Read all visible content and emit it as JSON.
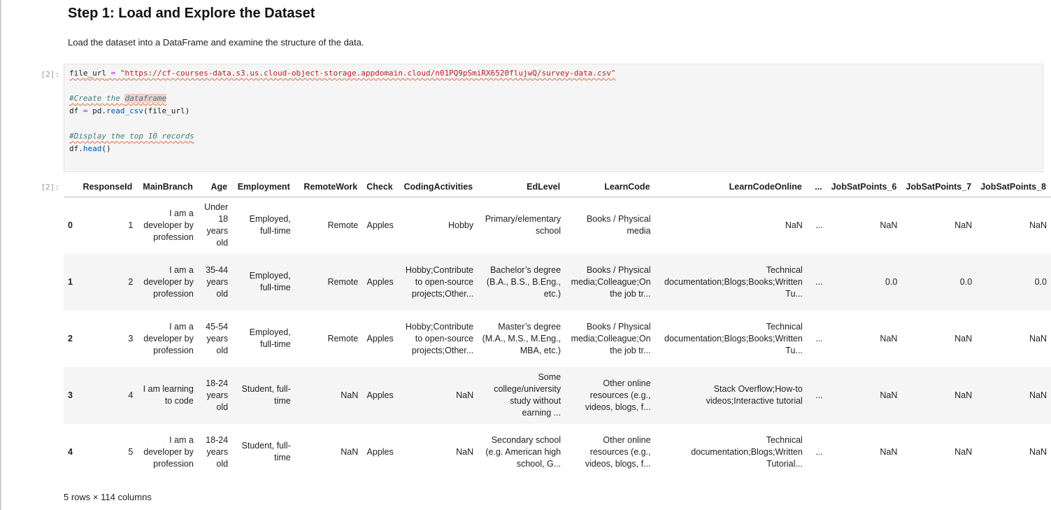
{
  "markdown": {
    "title": "Step 1: Load and Explore the Dataset",
    "text": "Load the dataset into a DataFrame and examine the structure of the data."
  },
  "code_cell": {
    "prompt": "[2]:",
    "line1_var": "file_url",
    "line1_eq": " = ",
    "line1_str": "\"https://cf-courses-data.s3.us.cloud-object-storage.appdomain.cloud/n01PQ9pSmiRX6520flujwQ/survey-data.csv\"",
    "comment1_a": "#Create the ",
    "comment1_b": "dataframe",
    "line2_a": "df ",
    "line2_eq": "=",
    "line2_b": " pd.",
    "line2_fn": "read_csv",
    "line2_c": "(file_url)",
    "comment2": "#Display the top 10 records",
    "line3_a": "df.",
    "line3_fn": "head",
    "line3_b": "()"
  },
  "output": {
    "prompt": "[2]:",
    "columns": [
      "",
      "ResponseId",
      "MainBranch",
      "Age",
      "Employment",
      "RemoteWork",
      "Check",
      "CodingActivities",
      "EdLevel",
      "LearnCode",
      "LearnCodeOnline",
      "...",
      "JobSatPoints_6",
      "JobSatPoints_7",
      "JobSatPoints_8"
    ],
    "rows": [
      [
        "0",
        "1",
        "I am a developer by profession",
        "Under 18 years old",
        "Employed, full-time",
        "Remote",
        "Apples",
        "Hobby",
        "Primary/elementary school",
        "Books / Physical media",
        "NaN",
        "...",
        "NaN",
        "NaN",
        "NaN"
      ],
      [
        "1",
        "2",
        "I am a developer by profession",
        "35-44 years old",
        "Employed, full-time",
        "Remote",
        "Apples",
        "Hobby;Contribute to open-source projects;Other...",
        "Bachelor’s degree (B.A., B.S., B.Eng., etc.)",
        "Books / Physical media;Colleague;On the job tr...",
        "Technical documentation;Blogs;Books;Written Tu...",
        "...",
        "0.0",
        "0.0",
        "0.0"
      ],
      [
        "2",
        "3",
        "I am a developer by profession",
        "45-54 years old",
        "Employed, full-time",
        "Remote",
        "Apples",
        "Hobby;Contribute to open-source projects;Other...",
        "Master’s degree (M.A., M.S., M.Eng., MBA, etc.)",
        "Books / Physical media;Colleague;On the job tr...",
        "Technical documentation;Blogs;Books;Written Tu...",
        "...",
        "NaN",
        "NaN",
        "NaN"
      ],
      [
        "3",
        "4",
        "I am learning to code",
        "18-24 years old",
        "Student, full-time",
        "NaN",
        "Apples",
        "NaN",
        "Some college/university study without earning ...",
        "Other online resources (e.g., videos, blogs, f...",
        "Stack Overflow;How-to videos;Interactive tutorial",
        "...",
        "NaN",
        "NaN",
        "NaN"
      ],
      [
        "4",
        "5",
        "I am a developer by profession",
        "18-24 years old",
        "Student, full-time",
        "NaN",
        "Apples",
        "NaN",
        "Secondary school (e.g. American high school, G...",
        "Other online resources (e.g., videos, blogs, f...",
        "Technical documentation;Blogs;Written Tutorial...",
        "...",
        "NaN",
        "NaN",
        "NaN"
      ]
    ],
    "footer": "5 rows × 114 columns"
  }
}
